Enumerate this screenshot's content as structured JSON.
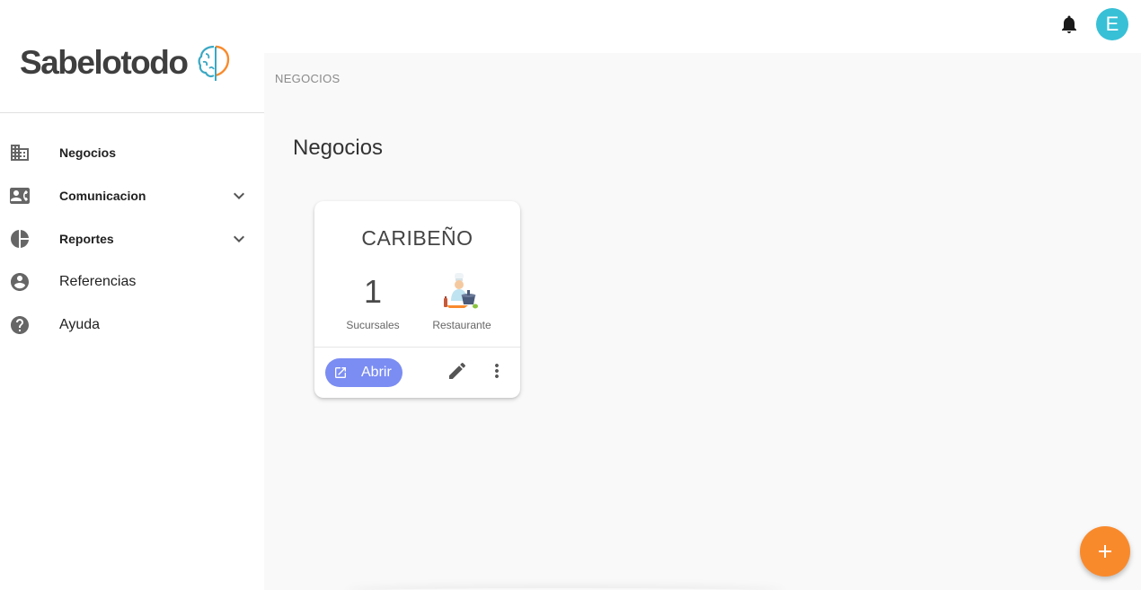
{
  "app": {
    "brand": "Sabelotodo",
    "accent_color": "#f98a2c",
    "primary_button_color": "#7b8df2",
    "avatar_color": "#38c0d6"
  },
  "topbar": {
    "notifications_icon": "bell-icon",
    "avatar_initial": "E"
  },
  "sidebar": {
    "items": [
      {
        "label": "Negocios",
        "icon": "business-icon",
        "expandable": false
      },
      {
        "label": "Comunicacion",
        "icon": "contact-card-icon",
        "expandable": true
      },
      {
        "label": "Reportes",
        "icon": "pie-chart-icon",
        "expandable": true
      },
      {
        "label": "Referencias",
        "icon": "account-circle-icon",
        "expandable": false
      },
      {
        "label": "Ayuda",
        "icon": "help-icon",
        "expandable": false
      }
    ]
  },
  "main": {
    "breadcrumb": "NEGOCIOS",
    "title": "Negocios",
    "cards": [
      {
        "name": "CARIBEÑO",
        "branches_count": "1",
        "branches_label": "Sucursales",
        "type_label": "Restaurante",
        "type_icon": "chef-icon",
        "open_label": "Abrir"
      }
    ]
  },
  "fab": {
    "icon": "plus-icon"
  }
}
